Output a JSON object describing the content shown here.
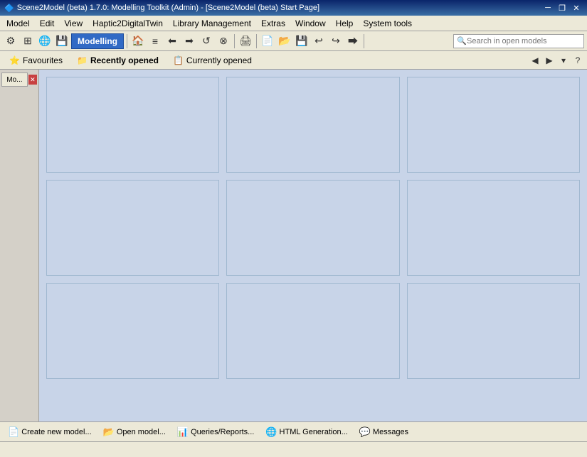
{
  "titlebar": {
    "title": "Scene2Model (beta) 1.7.0: Modelling Toolkit (Admin) - [Scene2Model (beta) Start Page]",
    "app_icon": "🔷",
    "btn_minimize": "─",
    "btn_restore": "❐",
    "btn_close": "✕"
  },
  "menubar": {
    "items": [
      {
        "label": "Model"
      },
      {
        "label": "Edit"
      },
      {
        "label": "View"
      },
      {
        "label": "Haptic2DigitalTwin"
      },
      {
        "label": "Library Management"
      },
      {
        "label": "Extras"
      },
      {
        "label": "Window"
      },
      {
        "label": "Help"
      },
      {
        "label": "System tools"
      }
    ]
  },
  "toolbar": {
    "label": "Modelling",
    "search_placeholder": "Search in open models",
    "home_icon": "🏠",
    "icons": [
      "📋",
      "🔁",
      "⬅",
      "➡",
      "◎",
      "📄",
      "📂",
      "💾",
      "↩",
      "↪",
      "⮕",
      "🔍"
    ]
  },
  "tabs": {
    "items": [
      {
        "label": "Favourites",
        "icon": "⭐",
        "active": false
      },
      {
        "label": "Recently opened",
        "icon": "📁",
        "active": true
      },
      {
        "label": "Currently opened",
        "icon": "📋",
        "active": false
      }
    ],
    "nav_back": "◀",
    "nav_forward": "▶",
    "nav_dropdown": "▾",
    "nav_help": "?"
  },
  "side_panel": {
    "tab_label": "Mo...",
    "close_label": "✕"
  },
  "grid": {
    "cells": [
      {},
      {},
      {},
      {},
      {},
      {},
      {},
      {},
      {}
    ]
  },
  "bottombar": {
    "buttons": [
      {
        "label": "Create new model...",
        "icon": "📄"
      },
      {
        "label": "Open model...",
        "icon": "📂"
      },
      {
        "label": "Queries/Reports...",
        "icon": "📊"
      },
      {
        "label": "HTML Generation...",
        "icon": "🌐"
      },
      {
        "label": "Messages",
        "icon": "💬"
      }
    ]
  },
  "statusbar": {
    "text": ""
  }
}
